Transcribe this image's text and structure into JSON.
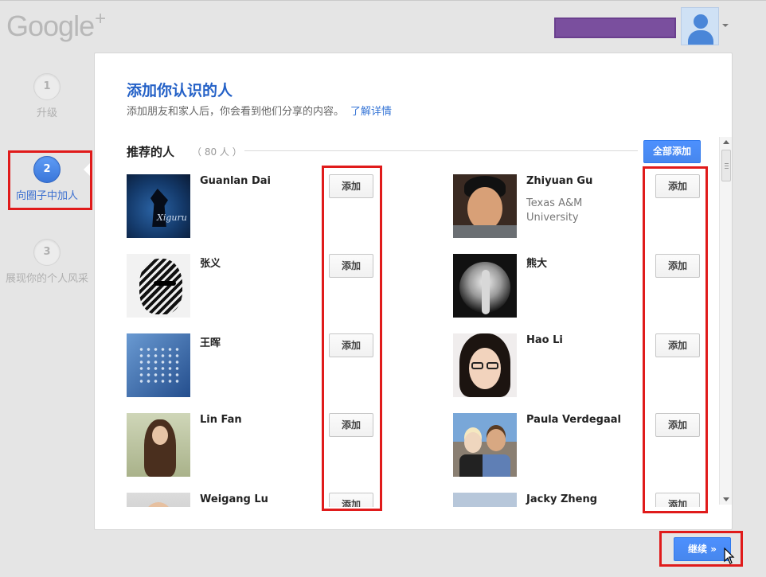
{
  "brand": {
    "logo_text": "Google",
    "logo_plus": "+"
  },
  "header": {
    "avatar_icon": "user-avatar-icon"
  },
  "steps": [
    {
      "number": "1",
      "label": "升级"
    },
    {
      "number": "2",
      "label": "向圈子中加人"
    },
    {
      "number": "3",
      "label": "展现你的个人风采"
    }
  ],
  "card": {
    "title": "添加你认识的人",
    "subtitle": "添加朋友和家人后，你会看到他们分享的内容。",
    "learn_more": "了解详情",
    "section_title": "推荐的人",
    "section_count": "（ 80 人 ）",
    "add_all_label": "全部添加"
  },
  "people": [
    {
      "name": "Guanlan Dai",
      "meta": "",
      "add_label": "添加"
    },
    {
      "name": "Zhiyuan Gu",
      "meta": "Texas A&M University",
      "add_label": "添加"
    },
    {
      "name": "张义",
      "meta": "",
      "add_label": "添加"
    },
    {
      "name": "熊大",
      "meta": "",
      "add_label": "添加"
    },
    {
      "name": "王晖",
      "meta": "",
      "add_label": "添加"
    },
    {
      "name": "Hao Li",
      "meta": "",
      "add_label": "添加"
    },
    {
      "name": "Lin Fan",
      "meta": "",
      "add_label": "添加"
    },
    {
      "name": "Paula Verdegaal",
      "meta": "",
      "add_label": "添加"
    },
    {
      "name": "Weigang Lu",
      "meta": "",
      "add_label": "添加"
    },
    {
      "name": "Jacky Zheng",
      "meta": "",
      "add_label": "添加"
    }
  ],
  "footer": {
    "continue_label": "继续 »"
  },
  "colors": {
    "accent": "#2461c7",
    "button_blue": "#4d90fe",
    "highlight_red": "#e01b1b",
    "active_step": "#3b6fd0"
  }
}
